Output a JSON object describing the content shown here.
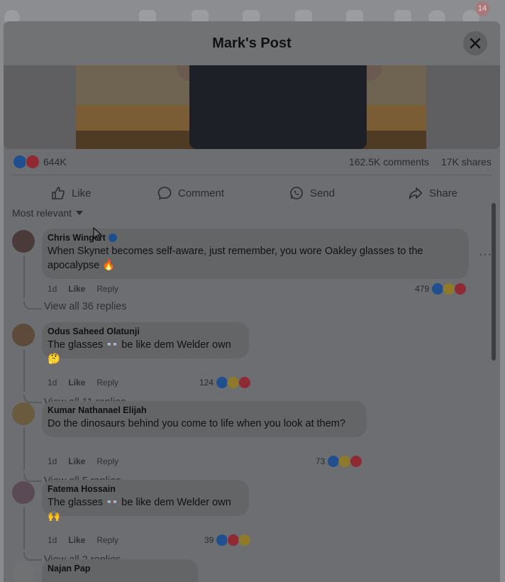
{
  "dialog": {
    "title": "Mark's Post"
  },
  "background": {
    "notification_badge": "14"
  },
  "post_stats": {
    "reactions": "644K",
    "comments": "162.5K comments",
    "shares": "17K shares"
  },
  "actions": {
    "like": "Like",
    "comment": "Comment",
    "send": "Send",
    "share": "Share"
  },
  "sort": {
    "label": "Most relevant"
  },
  "comments": [
    {
      "author": "Chris Wingert",
      "verified": true,
      "text": "When Skynet becomes self-aware, just remember, you wore Oakley glasses to the apocalypse 🔥",
      "time": "1d",
      "like": "Like",
      "reply": "Reply",
      "reaction_count": "479",
      "view_replies": "View all 36 replies"
    },
    {
      "author": "Odus Saheed Olatunji",
      "verified": false,
      "text": "The glasses 👓 be like dem Welder own🤔",
      "time": "1d",
      "like": "Like",
      "reply": "Reply",
      "reaction_count": "124",
      "view_replies": "View all 11 replies"
    },
    {
      "author": "Kumar Nathanael Elijah",
      "verified": false,
      "text": "Do the dinosaurs behind you come to life when you look at them?",
      "time": "1d",
      "like": "Like",
      "reply": "Reply",
      "reaction_count": "73",
      "view_replies": "View all 5 replies"
    },
    {
      "author": "Fatema Hossain",
      "verified": false,
      "text": "The glasses 👓 be like dem Welder own🙌",
      "time": "1d",
      "like": "Like",
      "reply": "Reply",
      "reaction_count": "39",
      "view_replies": "View all 2 replies"
    },
    {
      "author": "Najan Pap"
    }
  ],
  "colors": {
    "like_blue": "#1f4f8f",
    "love_red": "#8f2a33",
    "haha_yellow": "#8f7a2a"
  }
}
